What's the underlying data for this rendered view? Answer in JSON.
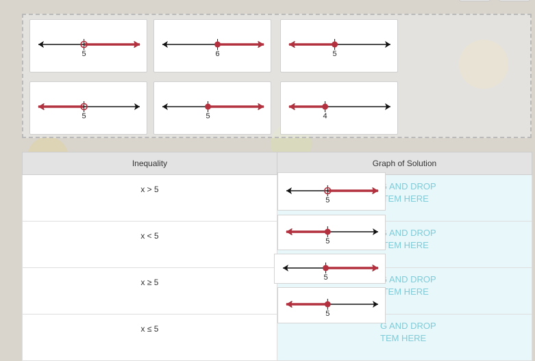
{
  "tray": {
    "cards": [
      {
        "label": "5",
        "point": "open",
        "direction": "right"
      },
      {
        "label": "6",
        "point": "closed",
        "direction": "right"
      },
      {
        "label": "5",
        "point": "closed",
        "direction": "left"
      },
      {
        "label": "5",
        "point": "open",
        "direction": "left"
      },
      {
        "label": "5",
        "point": "closed",
        "direction": "right"
      },
      {
        "label": "4",
        "point": "closed",
        "direction": "left"
      }
    ]
  },
  "table": {
    "headers": [
      "Inequality",
      "Graph of Solution"
    ],
    "rows": [
      {
        "inequality": "x > 5",
        "drop_text": "G AND DROP\nITEM HERE",
        "graph": {
          "label": "5",
          "point": "open",
          "direction": "right"
        }
      },
      {
        "inequality": "x < 5",
        "drop_text": "G AND DROP\nITEM HERE",
        "graph": {
          "label": "5",
          "point": "closed",
          "direction": "left"
        }
      },
      {
        "inequality": "x ≥ 5",
        "drop_text": "G AND DROP\nITEM HERE",
        "graph": {
          "label": "5",
          "point": "closed",
          "direction": "right"
        }
      },
      {
        "inequality": "x ≤ 5",
        "drop_text": "G AND DROP\nTEM HERE",
        "graph": {
          "label": "5",
          "point": "closed",
          "direction": "left"
        }
      }
    ]
  },
  "colors": {
    "ray": "#b3303e",
    "axis": "#111111",
    "drop_text": "#7fcbd8",
    "drop_bg": "#e7f7fa"
  },
  "icons": {
    "arrow": "arrowhead",
    "point_open": "open-circle-with-tick",
    "point_closed": "filled-dot"
  }
}
